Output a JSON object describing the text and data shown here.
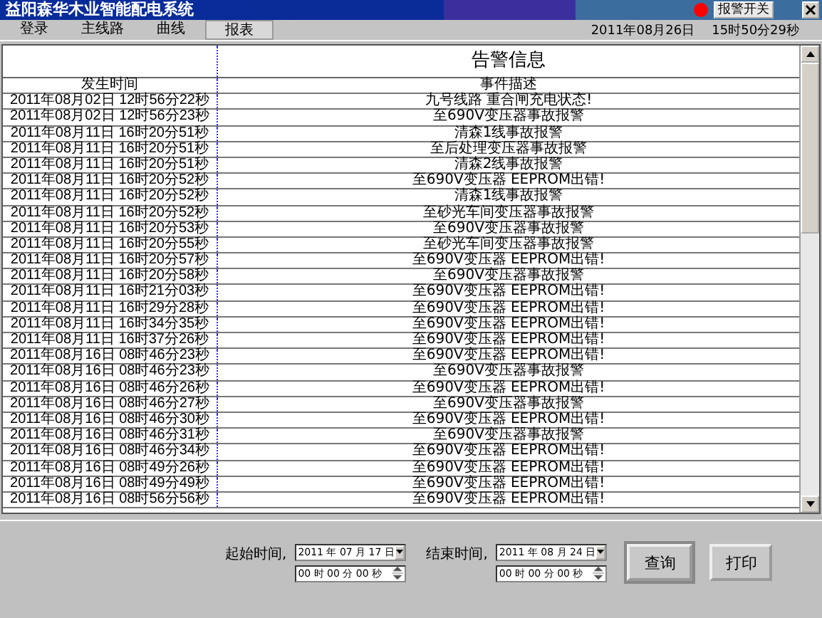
{
  "window": {
    "title": "益阳森华木业智能配电系统",
    "alarm_button": "报警开关"
  },
  "tabs": [
    {
      "label": "登录",
      "selected": false
    },
    {
      "label": "主线路",
      "selected": false
    },
    {
      "label": "曲线",
      "selected": false
    },
    {
      "label": "报表",
      "selected": true
    }
  ],
  "clock": {
    "date": "2011年08月26日",
    "time": "15时50分29秒"
  },
  "report": {
    "title": "告警信息",
    "columns": [
      "发生时间",
      "事件描述"
    ],
    "rows": [
      {
        "time": "2011年08月02日 12时56分22秒",
        "event": "九号线路 重合闸充电状态!"
      },
      {
        "time": "2011年08月02日 12时56分23秒",
        "event": "至690V变压器事故报警"
      },
      {
        "time": "2011年08月11日 16时20分51秒",
        "event": "清森1线事故报警"
      },
      {
        "time": "2011年08月11日 16时20分51秒",
        "event": "至后处理变压器事故报警"
      },
      {
        "time": "2011年08月11日 16时20分51秒",
        "event": "清森2线事故报警"
      },
      {
        "time": "2011年08月11日 16时20分52秒",
        "event": "至690V变压器 EEPROM出错!"
      },
      {
        "time": "2011年08月11日 16时20分52秒",
        "event": "清森1线事故报警"
      },
      {
        "time": "2011年08月11日 16时20分52秒",
        "event": "至砂光车间变压器事故报警"
      },
      {
        "time": "2011年08月11日 16时20分53秒",
        "event": "至690V变压器事故报警"
      },
      {
        "time": "2011年08月11日 16时20分55秒",
        "event": "至砂光车间变压器事故报警"
      },
      {
        "time": "2011年08月11日 16时20分57秒",
        "event": "至690V变压器 EEPROM出错!"
      },
      {
        "time": "2011年08月11日 16时20分58秒",
        "event": "至690V变压器事故报警"
      },
      {
        "time": "2011年08月11日 16时21分03秒",
        "event": "至690V变压器 EEPROM出错!"
      },
      {
        "time": "2011年08月11日 16时29分28秒",
        "event": "至690V变压器 EEPROM出错!"
      },
      {
        "time": "2011年08月11日 16时34分35秒",
        "event": "至690V变压器 EEPROM出错!"
      },
      {
        "time": "2011年08月11日 16时37分26秒",
        "event": "至690V变压器 EEPROM出错!"
      },
      {
        "time": "2011年08月16日 08时46分23秒",
        "event": "至690V变压器 EEPROM出错!"
      },
      {
        "time": "2011年08月16日 08时46分23秒",
        "event": "至690V变压器事故报警"
      },
      {
        "time": "2011年08月16日 08时46分26秒",
        "event": "至690V变压器 EEPROM出错!"
      },
      {
        "time": "2011年08月16日 08时46分27秒",
        "event": "至690V变压器事故报警"
      },
      {
        "time": "2011年08月16日 08时46分30秒",
        "event": "至690V变压器 EEPROM出错!"
      },
      {
        "time": "2011年08月16日 08时46分31秒",
        "event": "至690V变压器事故报警"
      },
      {
        "time": "2011年08月16日 08时46分34秒",
        "event": "至690V变压器 EEPROM出错!"
      },
      {
        "time": "2011年08月16日 08时49分26秒",
        "event": "至690V变压器 EEPROM出错!"
      },
      {
        "time": "2011年08月16日 08时49分49秒",
        "event": "至690V变压器 EEPROM出错!"
      },
      {
        "time": "2011年08月16日 08时56分56秒",
        "event": "至690V变压器 EEPROM出错!"
      }
    ]
  },
  "filter": {
    "start_label": "起始时间,",
    "start_date": "2011 年 07 月 17 日",
    "start_time": "00 时 00 分 00 秒",
    "end_label": "结束时间,",
    "end_date": "2011 年 08 月 24 日",
    "end_time": "00 时 00 分 00 秒"
  },
  "buttons": [
    {
      "label": "查询",
      "selected": true
    },
    {
      "label": "打印",
      "selected": false
    }
  ]
}
